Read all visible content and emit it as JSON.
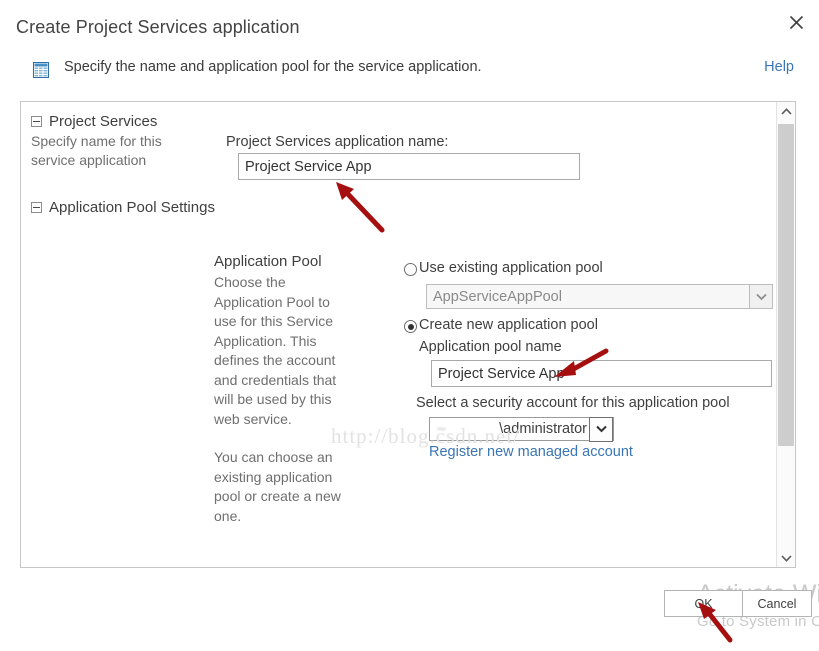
{
  "dialog": {
    "title": "Create Project Services application",
    "close_icon": "close-icon"
  },
  "subheader": {
    "icon": "list-table-icon",
    "text": "Specify the name and application pool for the service application.",
    "help_label": "Help"
  },
  "sidebar": {
    "sections": [
      {
        "heading": "Project Services",
        "description": "Specify name for this service application"
      },
      {
        "heading": "Application Pool Settings",
        "description": ""
      }
    ]
  },
  "description_column": {
    "title": "Application Pool",
    "paragraphs": [
      "Choose the Application Pool to use for this Service Application.  This defines the account and credentials that will be used by this web service.",
      "You can choose an existing application pool or create a new one."
    ]
  },
  "form": {
    "app_name_label": "Project Services application name:",
    "app_name_value": "Project Service App",
    "use_existing_label": "Use existing application pool",
    "use_existing_selected": false,
    "existing_pool_value": "AppServiceAppPool",
    "create_new_label": "Create new application pool",
    "create_new_selected": true,
    "pool_name_label": "Application pool name",
    "pool_name_value": "Project Service App",
    "security_account_label": "Select a security account for this application pool",
    "security_account_value": "\\administrator",
    "security_account_prefix": "∼",
    "register_link_label": "Register new managed account"
  },
  "scrollbar": {
    "up_icon": "chevron-up-icon",
    "down_icon": "chevron-down-icon"
  },
  "footer": {
    "ok_label": "OK",
    "cancel_label": "Cancel"
  },
  "watermarks": {
    "activate_line1": "Activate Wind",
    "activate_line2": "Go to System in C",
    "url": "http://blog.csdn.net/"
  },
  "colors": {
    "link": "#3a76b5",
    "annotation_arrow": "#a50f0f",
    "text": "#3f3f3f",
    "muted_text": "#6f6f6f",
    "border": "#c6c6c6"
  }
}
